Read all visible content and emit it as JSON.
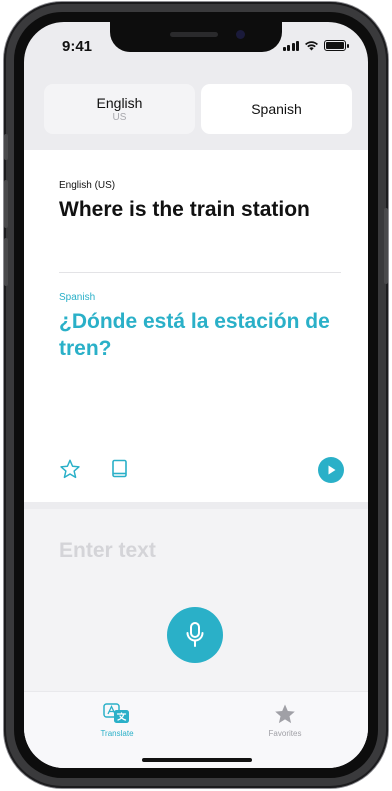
{
  "status_bar": {
    "time": "9:41"
  },
  "languages": {
    "source": {
      "name": "English",
      "region": "US"
    },
    "target": {
      "name": "Spanish"
    }
  },
  "translation": {
    "source_label": "English (US)",
    "source_text": "Where is the train station",
    "target_label": "Spanish",
    "target_text": "¿Dónde está la estación de tren?"
  },
  "input": {
    "placeholder": "Enter text"
  },
  "tabs": [
    {
      "label": "Translate",
      "active": true,
      "icon": "translate-icon"
    },
    {
      "label": "Favorites",
      "active": false,
      "icon": "star-filled-icon"
    }
  ],
  "colors": {
    "accent": "#2ab0c8",
    "text": "#111111",
    "muted": "#a0a0a6"
  }
}
